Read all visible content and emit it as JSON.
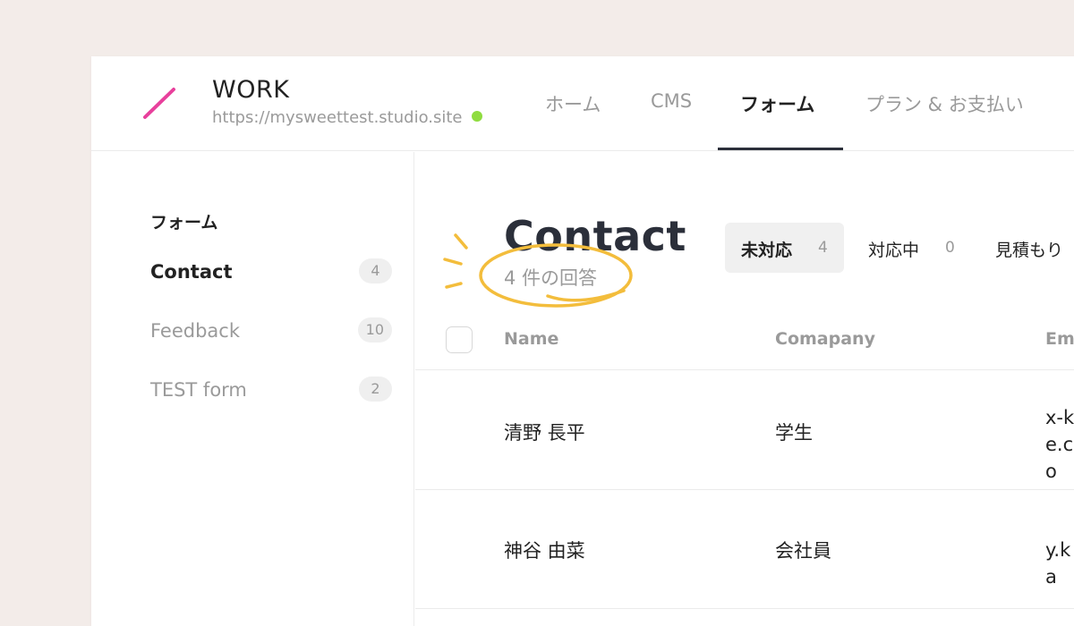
{
  "site": {
    "title": "WORK",
    "url": "https://mysweettest.studio.site",
    "status_color": "#8fdc3f",
    "logo_colors": [
      "#e8409c",
      "#f07cb8"
    ]
  },
  "nav": {
    "tabs": [
      {
        "label": "ホーム",
        "active": false
      },
      {
        "label": "CMS",
        "active": false
      },
      {
        "label": "フォーム",
        "active": true
      },
      {
        "label": "プラン & お支払い",
        "active": false
      }
    ]
  },
  "sidebar": {
    "heading": "フォーム",
    "forms": [
      {
        "label": "Contact",
        "count": "4",
        "active": true
      },
      {
        "label": "Feedback",
        "count": "10",
        "active": false
      },
      {
        "label": "TEST form",
        "count": "2",
        "active": false
      }
    ]
  },
  "main": {
    "title": "Contact",
    "response_count": "4 件の回答",
    "annotation_color": "#f3bd3c",
    "filters": [
      {
        "label": "未対応",
        "count": "4",
        "active": true
      },
      {
        "label": "対応中",
        "count": "0",
        "active": false
      },
      {
        "label": "見積もり",
        "count": "",
        "active": false
      }
    ],
    "table": {
      "columns": [
        "Name",
        "Comapany",
        "Em"
      ],
      "rows": [
        {
          "name": "清野 長平",
          "company": "学生",
          "email": "x-ke.co"
        },
        {
          "name": "神谷 由菜",
          "company": "会社員",
          "email": "y.ka"
        }
      ]
    }
  }
}
